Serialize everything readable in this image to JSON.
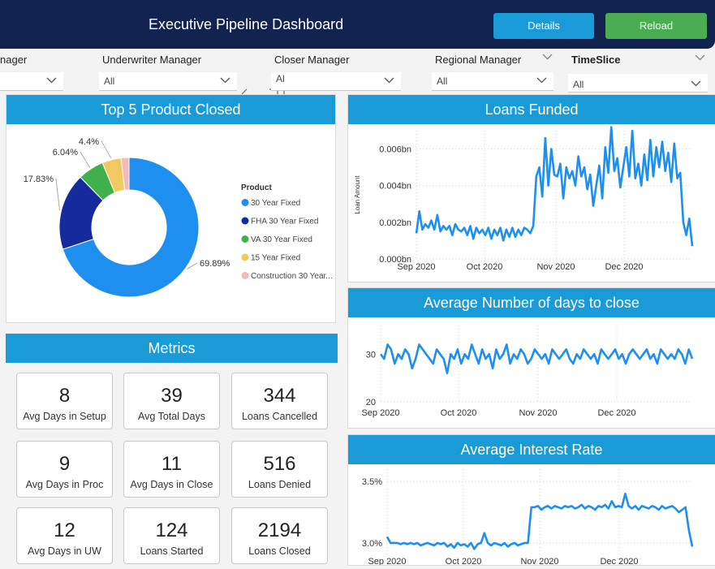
{
  "header": {
    "title": "Executive Pipeline Dashboard",
    "details_label": "Details",
    "reload_label": "Reload"
  },
  "filters": [
    {
      "label": "nager",
      "value": ""
    },
    {
      "label": "Underwriter Manager",
      "value": "All"
    },
    {
      "label": "Closer Manager",
      "value": "Al"
    },
    {
      "label": "Regional Manager",
      "value": "All"
    },
    {
      "label": "TimeSlice",
      "value": "All"
    }
  ],
  "donut": {
    "title": "Top 5 Product Closed",
    "legend_title": "Product",
    "chart_data": {
      "type": "pie",
      "categories": [
        "30 Year Fixed",
        "FHA 30 Year Fixed",
        "VA 30 Year Fixed",
        "15 Year Fixed",
        "Construction 30 Year..."
      ],
      "values": [
        69.89,
        17.83,
        6.04,
        4.4,
        1.84
      ],
      "labels": [
        "69.89%",
        "17.83%",
        "6.04%",
        "4.4%",
        ""
      ],
      "colors": [
        "#1e8fef",
        "#152a9c",
        "#3fb04c",
        "#f2c960",
        "#f6b9b9"
      ]
    }
  },
  "metrics": {
    "title": "Metrics",
    "items": [
      {
        "value": "8",
        "label": "Avg Days in Setup"
      },
      {
        "value": "39",
        "label": "Avg Total Days"
      },
      {
        "value": "344",
        "label": "Loans Cancelled"
      },
      {
        "value": "9",
        "label": "Avg Days in Proc"
      },
      {
        "value": "11",
        "label": "Avg Days in Close"
      },
      {
        "value": "516",
        "label": "Loans Denied"
      },
      {
        "value": "12",
        "label": "Avg Days in UW"
      },
      {
        "value": "124",
        "label": "Loans Started"
      },
      {
        "value": "2194",
        "label": "Loans Closed"
      }
    ]
  },
  "charts": {
    "funded": {
      "title": "Loans Funded",
      "ylabel": "Loan Amount",
      "yticks": [
        "0.000bn",
        "0.002bn",
        "0.004bn",
        "0.006bn"
      ],
      "xticks": [
        "Sep 2020",
        "Oct 2020",
        "Nov 2020",
        "Dec 2020"
      ],
      "chart_data": {
        "type": "line",
        "ylim": [
          0,
          0.007
        ],
        "values": [
          0.0014,
          0.0026,
          0.0016,
          0.0019,
          0.0017,
          0.0021,
          0.0016,
          0.0024,
          0.0015,
          0.0018,
          0.0016,
          0.0018,
          0.0013,
          0.0019,
          0.0016,
          0.0015,
          0.0017,
          0.0013,
          0.0018,
          0.0011,
          0.0017,
          0.0014,
          0.0016,
          0.0013,
          0.0017,
          0.0011,
          0.0016,
          0.0013,
          0.0017,
          0.001,
          0.0016,
          0.0012,
          0.0017,
          0.0012,
          0.0016,
          0.0013,
          0.0017,
          0.0016,
          0.0014,
          0.0018,
          0.0045,
          0.005,
          0.0034,
          0.0066,
          0.004,
          0.006,
          0.0046,
          0.0045,
          0.0052,
          0.0033,
          0.005,
          0.0044,
          0.0048,
          0.004,
          0.0056,
          0.0045,
          0.005,
          0.0038,
          0.0046,
          0.0029,
          0.004,
          0.0051,
          0.0033,
          0.0061,
          0.0047,
          0.0072,
          0.0048,
          0.0055,
          0.0039,
          0.005,
          0.0061,
          0.0045,
          0.007,
          0.0044,
          0.0052,
          0.004,
          0.0057,
          0.0043,
          0.0065,
          0.0045,
          0.0061,
          0.005,
          0.0064,
          0.0048,
          0.0058,
          0.0042,
          0.0063,
          0.0044,
          0.0047,
          0.002,
          0.0013,
          0.0022,
          0.0007
        ]
      }
    },
    "days": {
      "title": "Average Number of days to close",
      "yticks": [
        "20",
        "30"
      ],
      "xticks": [
        "Sep 2020",
        "Oct 2020",
        "Nov 2020",
        "Dec 2020"
      ],
      "chart_data": {
        "type": "line",
        "ylim": [
          20,
          36
        ],
        "values": [
          30,
          29,
          32,
          31,
          28,
          30,
          29,
          31,
          30,
          27,
          29,
          32,
          31,
          30,
          29,
          28,
          31,
          30,
          29,
          26,
          30,
          29,
          31,
          28,
          30,
          29,
          32,
          30,
          28,
          31,
          29,
          30,
          27,
          31,
          29,
          30,
          32,
          28,
          30,
          29,
          31,
          30,
          28,
          29,
          31,
          30,
          29,
          30,
          28,
          31,
          30,
          29,
          30,
          31,
          29,
          28,
          30,
          29,
          31,
          30,
          29,
          30,
          28,
          31,
          30,
          29,
          30,
          31,
          29,
          30,
          28,
          30,
          31,
          30,
          29,
          30,
          31,
          29,
          30,
          28,
          31,
          30,
          29,
          30,
          29,
          31,
          30,
          28,
          31,
          29
        ]
      }
    },
    "rate": {
      "title": "Average Interest Rate",
      "yticks": [
        "3.0%",
        "3.5%"
      ],
      "xticks": [
        "Sep 2020",
        "Oct 2020",
        "Nov 2020",
        "Dec 2020"
      ],
      "chart_data": {
        "type": "line",
        "ylim": [
          2.9,
          3.6
        ],
        "values": [
          3.05,
          3.0,
          3.0,
          3.0,
          2.99,
          3.0,
          2.99,
          3.0,
          2.99,
          3.0,
          2.98,
          2.99,
          3.0,
          2.99,
          2.98,
          3.0,
          2.99,
          3.0,
          2.97,
          2.99,
          2.96,
          3.0,
          2.98,
          2.99,
          2.97,
          3.0,
          2.95,
          2.99,
          3.0,
          3.08,
          3.0,
          2.98,
          3.0,
          2.99,
          2.98,
          3.0,
          2.97,
          2.99,
          3.0,
          2.98,
          2.99,
          3.0,
          3.0,
          3.29,
          3.29,
          3.3,
          3.27,
          3.29,
          3.3,
          3.28,
          3.3,
          3.29,
          3.28,
          3.3,
          3.29,
          3.3,
          3.28,
          3.29,
          3.31,
          3.28,
          3.3,
          3.29,
          3.27,
          3.3,
          3.29,
          3.31,
          3.28,
          3.34,
          3.29,
          3.3,
          3.29,
          3.4,
          3.3,
          3.28,
          3.3,
          3.27,
          3.3,
          3.29,
          3.28,
          3.3,
          3.29,
          3.27,
          3.3,
          3.28,
          3.29,
          3.3,
          3.28,
          3.25,
          3.27,
          3.29,
          3.1,
          2.97
        ]
      }
    }
  }
}
